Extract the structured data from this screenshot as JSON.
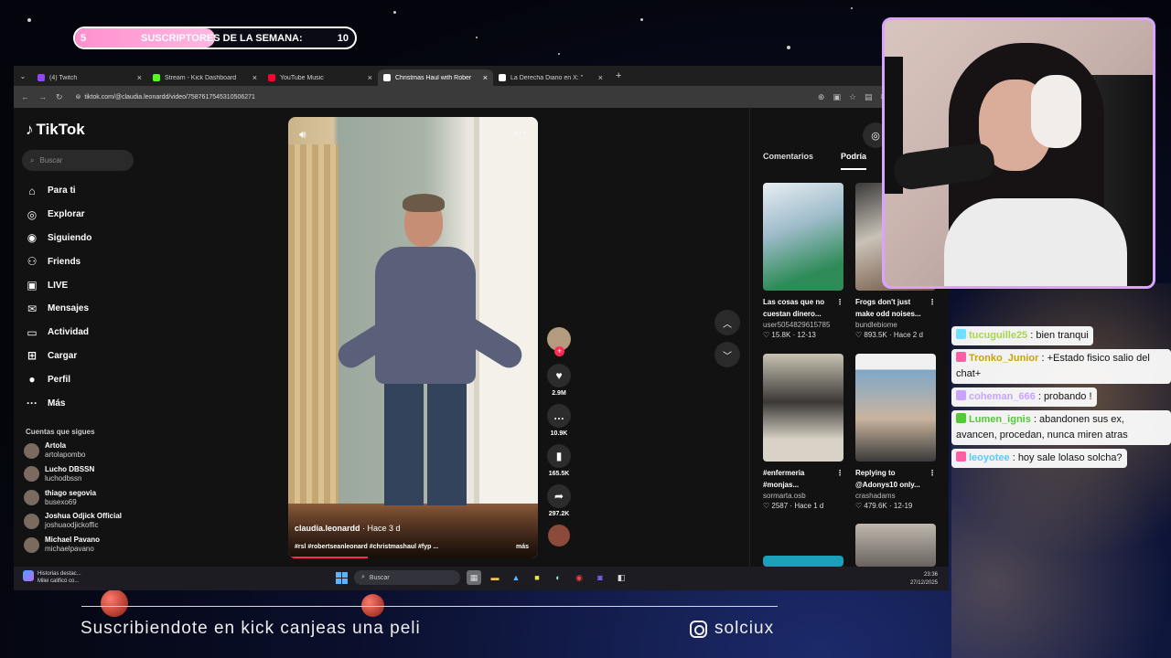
{
  "subgoal": {
    "current": "5",
    "label": "SUSCRIPTORES DE LA SEMANA:",
    "goal": "10",
    "progress_fraction": 0.5
  },
  "browser": {
    "tabs": [
      {
        "title": "(4) Twitch",
        "color": "#9146ff",
        "active": false
      },
      {
        "title": "Stream - Kick Dashboard",
        "color": "#53fc18",
        "active": false
      },
      {
        "title": "YouTube Music",
        "color": "#ff0033",
        "active": false
      },
      {
        "title": "Christmas Haul with Rober",
        "color": "#ffffff",
        "active": true
      },
      {
        "title": "La Derecha Diario en X: \"",
        "color": "#ffffff",
        "active": false
      }
    ],
    "new_tab": "+",
    "url": "tiktok.com/@claudia.leonardd/video/7587617545310506271"
  },
  "tiktok": {
    "logo": "TikTok",
    "search_placeholder": "Buscar",
    "nav": [
      {
        "label": "Para ti",
        "icon": "home-icon",
        "glyph": "⌂"
      },
      {
        "label": "Explorar",
        "icon": "compass-icon",
        "glyph": "◎"
      },
      {
        "label": "Siguiendo",
        "icon": "following-icon",
        "glyph": "◉"
      },
      {
        "label": "Friends",
        "icon": "friends-icon",
        "glyph": "⚇"
      },
      {
        "label": "LIVE",
        "icon": "live-icon",
        "glyph": "▣"
      },
      {
        "label": "Mensajes",
        "icon": "messages-icon",
        "glyph": "✉"
      },
      {
        "label": "Actividad",
        "icon": "activity-icon",
        "glyph": "▭"
      },
      {
        "label": "Cargar",
        "icon": "upload-icon",
        "glyph": "⊞"
      },
      {
        "label": "Perfil",
        "icon": "profile-icon",
        "glyph": "●"
      },
      {
        "label": "Más",
        "icon": "more-icon",
        "glyph": "···"
      }
    ],
    "following_title": "Cuentas que sigues",
    "following": [
      {
        "name": "Artola",
        "handle": "artolapombo"
      },
      {
        "name": "Lucho DBSSN",
        "handle": "luchodbssn"
      },
      {
        "name": "thiago segovia",
        "handle": "busexo69"
      },
      {
        "name": "Joshua Odjick Official",
        "handle": "joshuaodjickoffic"
      },
      {
        "name": "Michael Pavano",
        "handle": "michaelpavano"
      }
    ],
    "video": {
      "author": "claudia.leonardd",
      "time": " · Hace 3 d",
      "tags": "#rsl #robertseanleonard #christmashaul #fyp ...",
      "more": "más",
      "progress_fraction": 0.32
    },
    "actions": {
      "likes": "2.9M",
      "comments": "10.9K",
      "saves": "165.5K",
      "shares": "297.2K"
    },
    "right_tabs": [
      "Comentarios",
      "Podría"
    ],
    "cards": [
      {
        "title": "Las cosas que no cuestan dinero...",
        "author": "user5054829615785",
        "views": "15.8K",
        "date": "12-13"
      },
      {
        "title": "Frogs don't just make odd noises...",
        "author": "bundlebiome",
        "views": "893.5K",
        "date": "Hace 2 d"
      },
      {
        "title": "#enfermeria #monjas...",
        "author": "sormarta.osb",
        "views": "2587",
        "date": "Hace 1 d"
      },
      {
        "title": "Replying to @Adonys10 only...",
        "author": "crashadams",
        "views": "479.6K",
        "date": "12-19"
      }
    ]
  },
  "taskbar": {
    "news_title": "Historias destac...",
    "news_sub": "Milei calificó co...",
    "search": "Buscar",
    "time": "23:36",
    "date": "27/12/2025"
  },
  "chat": [
    {
      "user": "tucuguille25",
      "text": ": bien tranqui",
      "user_color": "#a7d64b",
      "badge": "#6fe0ff"
    },
    {
      "user": "Tronko_Junior",
      "text": ": +Estado fisico salio del chat+",
      "user_color": "#c9a300",
      "badge": "#ff5fa2"
    },
    {
      "user": "coheman_666",
      "text": ": probando !",
      "user_color": "#c8a3ff",
      "badge": "#c8a3ff"
    },
    {
      "user": "Lumen_ignis",
      "text": ": abandonen sus ex, avancen, procedan, nunca miren atras",
      "user_color": "#53c936",
      "badge": "#53c936"
    },
    {
      "user": "leoyotee",
      "text": ": hoy sale lolaso solcha?",
      "user_color": "#5ac8ff",
      "badge": "#ff5fa2"
    }
  ],
  "footer": {
    "promo": "Suscribiendote en kick canjeas una peli",
    "instagram": "solciux"
  }
}
